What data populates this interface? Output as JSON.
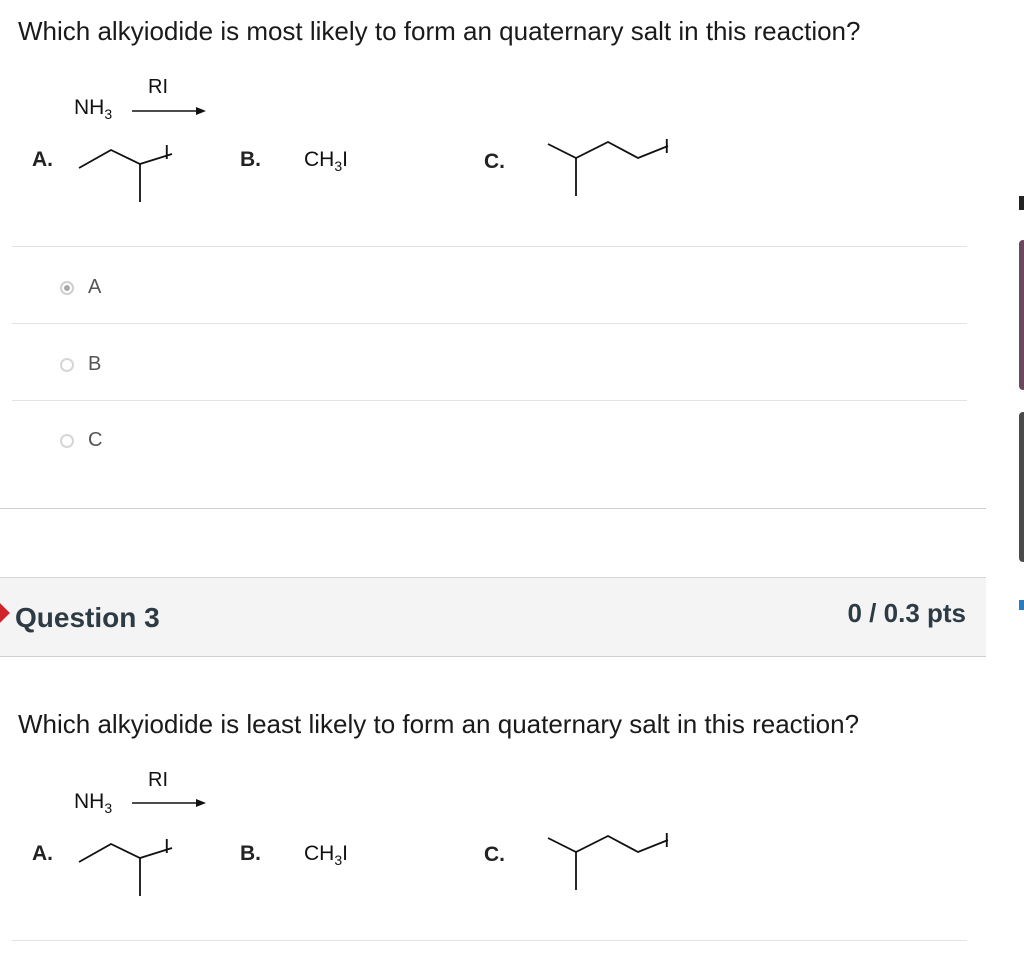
{
  "question2": {
    "text": "Which alkyiodide is most likely to form an quaternary salt in this reaction?",
    "reaction": {
      "reactant": "NH",
      "reactant_sub": "3",
      "reagent": "RI"
    },
    "options": [
      {
        "letter": "A.",
        "iodide": "I"
      },
      {
        "letter": "B.",
        "formula": "CH",
        "formula_sub": "3",
        "formula_tail": "I"
      },
      {
        "letter": "C.",
        "iodide": "I"
      }
    ],
    "answers": [
      {
        "label": "A",
        "selected": true
      },
      {
        "label": "B",
        "selected": false
      },
      {
        "label": "C",
        "selected": false
      }
    ]
  },
  "question3": {
    "title": "Question 3",
    "points": "0 / 0.3 pts",
    "text": "Which alkyiodide is least likely to form an quaternary salt in this reaction?",
    "reaction": {
      "reactant": "NH",
      "reactant_sub": "3",
      "reagent": "RI"
    },
    "options": [
      {
        "letter": "A.",
        "iodide": "I"
      },
      {
        "letter": "B.",
        "formula": "CH",
        "formula_sub": "3",
        "formula_tail": "I"
      },
      {
        "letter": "C.",
        "iodide": "I"
      }
    ]
  },
  "colors": {
    "flag": "#d1232a",
    "header_bg": "#f4f4f4",
    "title_text": "#2d3b45"
  }
}
